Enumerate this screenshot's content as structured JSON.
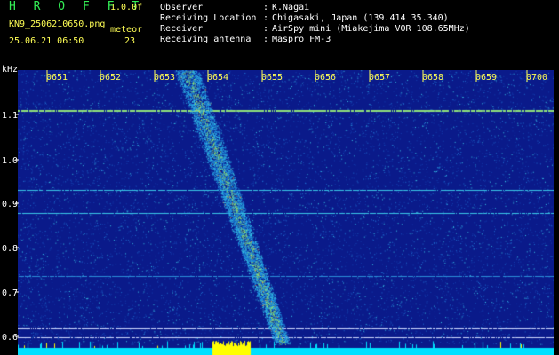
{
  "header": {
    "brand": "H R O F F T",
    "version": "1.0.0f",
    "filename": "KN9_2506210650.png",
    "datetime": "25.06.21 06:50",
    "meteor_label": "meteor",
    "meteor_count": "23",
    "info": [
      {
        "label": "Observer",
        "value": "K.Nagai"
      },
      {
        "label": "Receiving Location",
        "value": "Chigasaki, Japan (139.414 35.340)"
      },
      {
        "label": "Receiver",
        "value": "AirSpy mini (Miakejima VOR 108.65MHz)"
      },
      {
        "label": "Receiving antenna",
        "value": "Maspro FM-3"
      }
    ]
  },
  "axis": {
    "unit": "kHz",
    "time_ticks": [
      "0651",
      "0652",
      "0653",
      "0654",
      "0655",
      "0656",
      "0657",
      "0658",
      "0659",
      "0700"
    ],
    "freq_ticks": [
      "1.1",
      "1.0",
      "0.9",
      "0.8",
      "0.7",
      "0.6"
    ]
  },
  "colors": {
    "background": "#0a1a8a",
    "noise_cyan": "#39c6e6",
    "line_green": "#88dd66",
    "text_yellow": "#ffff55",
    "text_green": "#33ee55",
    "bottom_bar": "#00e0ff",
    "bottom_peak": "#ffff00"
  },
  "chart_data": {
    "type": "heatmap",
    "x": [
      "0651",
      "0652",
      "0653",
      "0654",
      "0655",
      "0656",
      "0657",
      "0658",
      "0659",
      "0700"
    ],
    "ylabel": "kHz",
    "ylim": [
      0.58,
      1.18
    ]
  }
}
